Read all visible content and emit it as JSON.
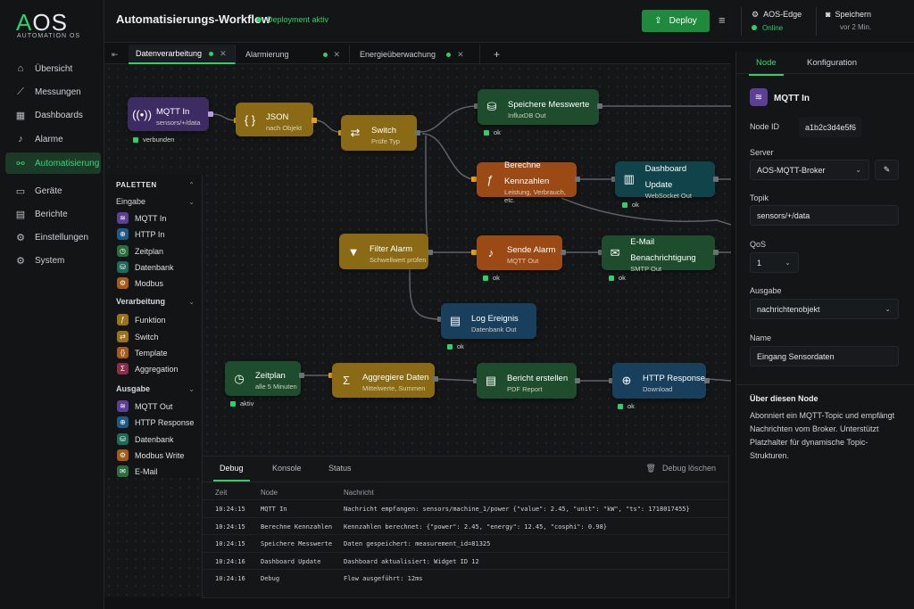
{
  "app": {
    "logo": "AOS",
    "logo_sub": "AUTOMATION OS"
  },
  "nav": [
    {
      "label": "Übersicht",
      "icon": "home-icon"
    },
    {
      "label": "Messungen",
      "icon": "chart-icon"
    },
    {
      "label": "Dashboards",
      "icon": "dashboard-icon"
    },
    {
      "label": "Alarme",
      "icon": "bell-icon"
    },
    {
      "label": "Automatisierung",
      "icon": "flow-icon",
      "active": true
    },
    {
      "label": "Geräte",
      "icon": "device-icon"
    },
    {
      "label": "Berichte",
      "icon": "report-icon"
    },
    {
      "label": "Einstellungen",
      "icon": "gear-icon"
    },
    {
      "label": "System",
      "icon": "system-icon"
    }
  ],
  "header": {
    "title": "Automatisierungs-Workflow",
    "status": "Deployment aktiv",
    "deploy": "Deploy",
    "edge": {
      "title": "AOS-Edge",
      "sub": "Online"
    },
    "save": {
      "title": "Speichern",
      "sub": "vor 2 Min."
    }
  },
  "tabs": [
    {
      "label": "Datenverarbeitung"
    },
    {
      "label": "Alarmierung"
    },
    {
      "label": "Energieüberwachung"
    }
  ],
  "nodes": {
    "mqtt": {
      "title": "MQTT In",
      "sub": "sensors/+/data",
      "status": "verbunden"
    },
    "json": {
      "title": "JSON",
      "sub": "nach Objekt"
    },
    "switch": {
      "title": "Switch",
      "sub": "Prüfe Typ"
    },
    "speichere": {
      "title": "Speichere Messwerte",
      "sub": "InfluxDB Out",
      "status": "ok"
    },
    "berechne": {
      "title": "Berechne Kennzahlen",
      "sub": "Leistung, Verbrauch, etc."
    },
    "dashboard": {
      "title": "Dashboard Update",
      "sub": "WebSocket Out",
      "status": "ok"
    },
    "filter": {
      "title": "Filter Alarm",
      "sub": "Schwellwert prüfen"
    },
    "sende": {
      "title": "Sende Alarm",
      "sub": "MQTT Out",
      "status": "ok"
    },
    "email": {
      "title": "E-Mail Benachrichtigung",
      "sub": "SMTP Out",
      "status": "ok"
    },
    "log": {
      "title": "Log Ereignis",
      "sub": "Datenbank Out",
      "status": "ok"
    },
    "zeitplan": {
      "title": "Zeitplan",
      "sub": "alle 5 Minuten",
      "status": "aktiv"
    },
    "aggregiere": {
      "title": "Aggregiere Daten",
      "sub": "Mittelwerte, Summen"
    },
    "bericht": {
      "title": "Bericht erstellen",
      "sub": "PDF Report"
    },
    "http": {
      "title": "HTTP Response",
      "sub": "Download",
      "status": "ok"
    }
  },
  "palette": {
    "title": "PALETTEN",
    "groups": [
      {
        "label": "Eingabe",
        "items": [
          "MQTT In",
          "HTTP In",
          "Zeitplan",
          "Datenbank",
          "Modbus"
        ]
      },
      {
        "label": "Verarbeitung",
        "items": [
          "Funktion",
          "Switch",
          "Template",
          "Aggregation"
        ]
      },
      {
        "label": "Ausgabe",
        "items": [
          "MQTT Out",
          "HTTP Response",
          "Datenbank",
          "Modbus Write",
          "E-Mail"
        ]
      }
    ]
  },
  "debug": {
    "tabs": [
      "Debug",
      "Konsole",
      "Status"
    ],
    "clear": "Debug löschen",
    "cols": [
      "Zeit",
      "Node",
      "Nachricht"
    ],
    "rows": [
      {
        "t": "10:24:15",
        "n": "MQTT In",
        "m": "Nachricht empfangen: sensors/machine_1/power {\"value\": 2.45, \"unit\": \"kW\", \"ts\": 1718017455}"
      },
      {
        "t": "10:24:15",
        "n": "Berechne Kennzahlen",
        "m": "Kennzahlen berechnet: {\"power\": 2.45, \"energy\": 12.45, \"cosphi\": 0.98}"
      },
      {
        "t": "10:24:15",
        "n": "Speichere Messwerte",
        "m": "Daten gespeichert: measurement_id=81325"
      },
      {
        "t": "10:24:16",
        "n": "Dashboard Update",
        "m": "Dashboard aktualisiert: Widget ID 12"
      },
      {
        "t": "10:24:16",
        "n": "Debug",
        "m": "Flow ausgeführt: 12ms"
      }
    ]
  },
  "panel": {
    "tabs": [
      "Node",
      "Konfiguration"
    ],
    "node_title": "MQTT In",
    "node_id_label": "Node ID",
    "node_id": "a1b2c3d4e5f6",
    "server_label": "Server",
    "server": "AOS-MQTT-Broker",
    "topic_label": "Topik",
    "topic": "sensors/+/data",
    "qos_label": "QoS",
    "qos": "1",
    "output_label": "Ausgabe",
    "output": "nachrichtenobjekt",
    "name_label": "Name",
    "name": "Eingang Sensordaten",
    "about_title": "Über diesen Node",
    "about_text": "Abonniert ein MQTT-Topic und empfängt Nachrichten vom Broker. Unterstützt Platzhalter für dynamische Topic-Strukturen."
  }
}
